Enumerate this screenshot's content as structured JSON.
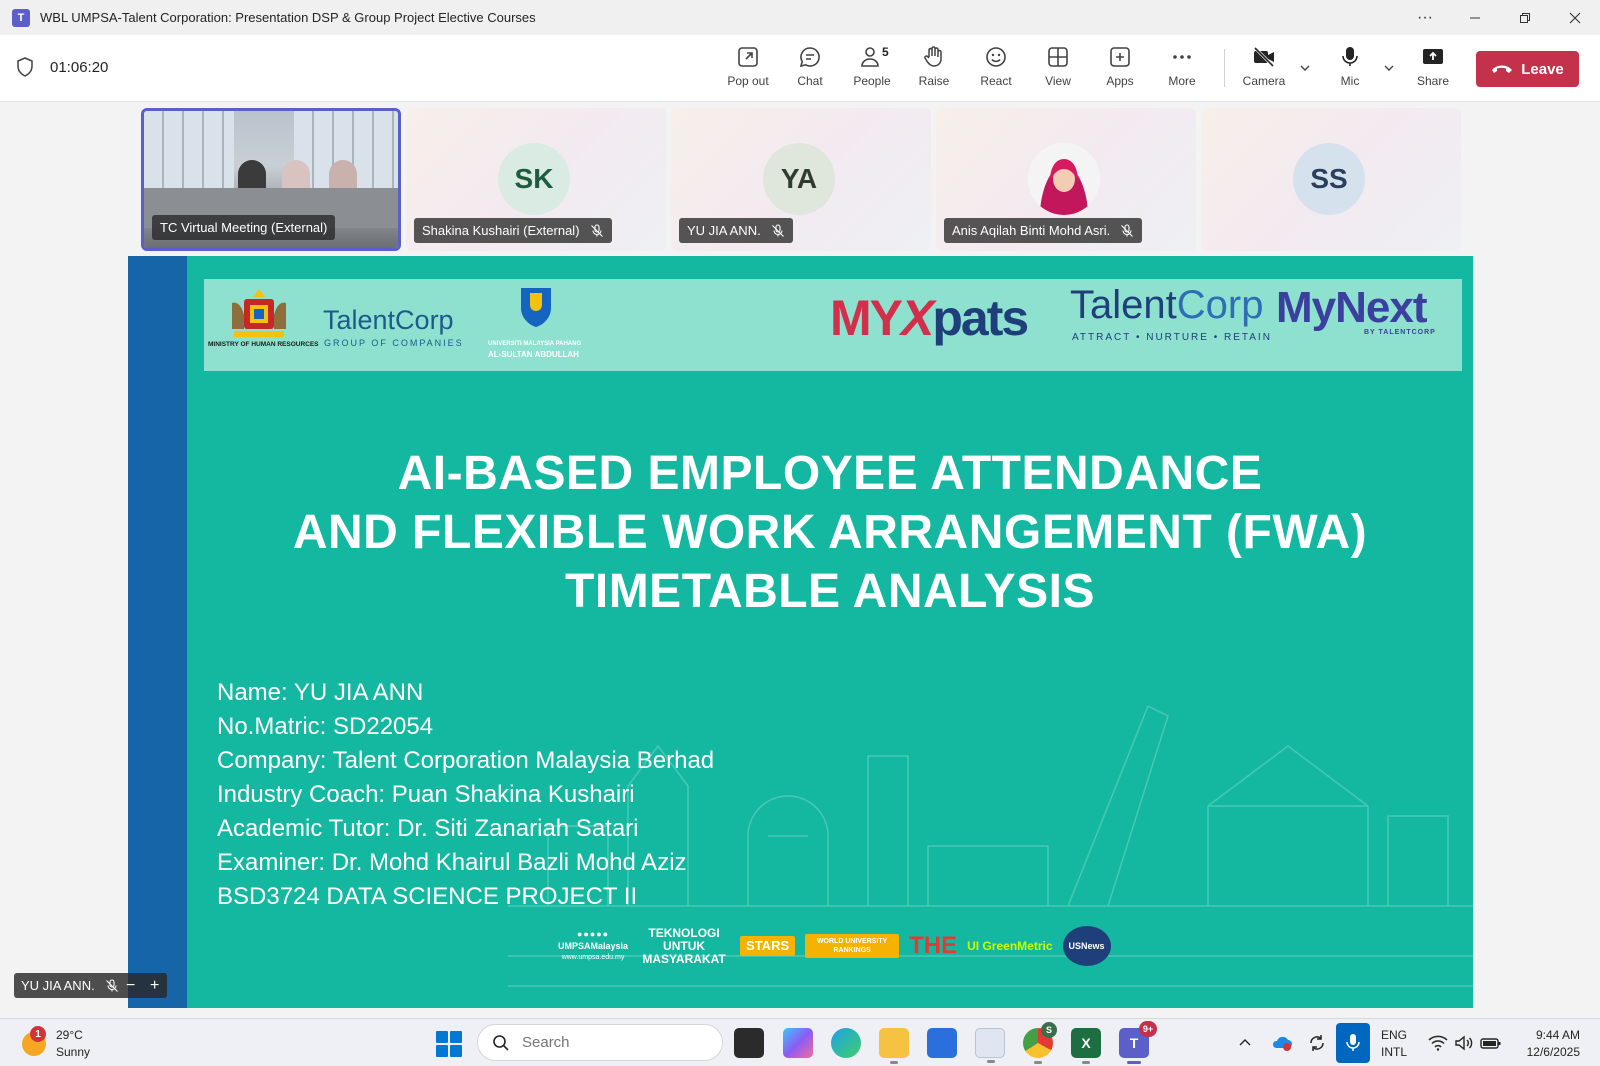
{
  "window": {
    "title": "WBL UMPSA-Talent Corporation: Presentation DSP & Group Project Elective Courses",
    "menu_label": "···"
  },
  "toolbar": {
    "timer": "01:06:20",
    "pop_out": "Pop out",
    "chat": "Chat",
    "people": "People",
    "people_count": "5",
    "raise": "Raise",
    "react": "React",
    "view": "View",
    "apps": "Apps",
    "more": "More",
    "camera": "Camera",
    "mic": "Mic",
    "share": "Share",
    "leave": "Leave"
  },
  "participants": [
    {
      "name": "TC Virtual Meeting (External)",
      "type": "video"
    },
    {
      "name": "Shakina Kushairi (External)",
      "initials": "SK",
      "avatar_bg": "#d9ebe2",
      "avatar_fg": "#1e5b3f"
    },
    {
      "name": "YU JIA ANN.",
      "initials": "YA",
      "avatar_bg": "#dfe6dc",
      "avatar_fg": "#2f3d2e"
    },
    {
      "name": "Anis Aqilah Binti Mohd Asri.",
      "type": "photo"
    },
    {
      "initials": "SS",
      "avatar_bg": "#d6e1ee",
      "avatar_fg": "#2a3f5c"
    }
  ],
  "slide": {
    "logos": {
      "ministry": "MINISTRY OF HUMAN RESOURCES",
      "talentcorp_group": "TalentCorp",
      "group_of_companies": "GROUP OF COMPANIES",
      "umpsa_line1": "UNIVERSITI MALAYSIA PAHANG",
      "umpsa_line2": "AL-SULTAN ABDULLAH",
      "myx_1": "MY",
      "myx_2": "X",
      "myx_3": "pats",
      "talentcorp_talent": "Talent",
      "talentcorp_corp": "Corp",
      "talentcorp_tagline": "ATTRACT • NURTURE • RETAIN",
      "mynext": "MyNext",
      "mynext_by": "BY TALENTCORP"
    },
    "title_lines": [
      "AI-BASED EMPLOYEE ATTENDANCE",
      "AND FLEXIBLE WORK ARRANGEMENT (FWA)",
      "TIMETABLE ANALYSIS"
    ],
    "details": [
      "Name: YU JIA ANN",
      "No.Matric: SD22054",
      "Company: Talent Corporation Malaysia Berhad",
      "Industry Coach: Puan Shakina Kushairi",
      "Academic Tutor: Dr. Siti Zanariah Satari",
      "Examiner: Dr. Mohd Khairul Bazli Mohd Aziz",
      "BSD3724 DATA SCIENCE PROJECT II"
    ],
    "bottom_logos": {
      "umpsa_social": "UMPSAMalaysia",
      "umpsa_url": "www.umpsa.edu.my",
      "tagline": "TEKNOLOGI UNTUK MASYARAKAT",
      "qs_stars": "STARS",
      "qs_rankings": "WORLD UNIVERSITY RANKINGS",
      "the": "THE",
      "ui_green": "UI GreenMetric",
      "usnews": "USNews"
    }
  },
  "self_view": {
    "name": "YU JIA ANN.",
    "minus": "−",
    "plus": "+"
  },
  "taskbar": {
    "weather_badge": "1",
    "temperature": "29°C",
    "condition": "Sunny",
    "search_placeholder": "Search",
    "chrome_badge": "S",
    "teams_badge": "9+",
    "lang_line1": "ENG",
    "lang_line2": "INTL",
    "time": "9:44 AM",
    "date": "12/6/2025"
  }
}
